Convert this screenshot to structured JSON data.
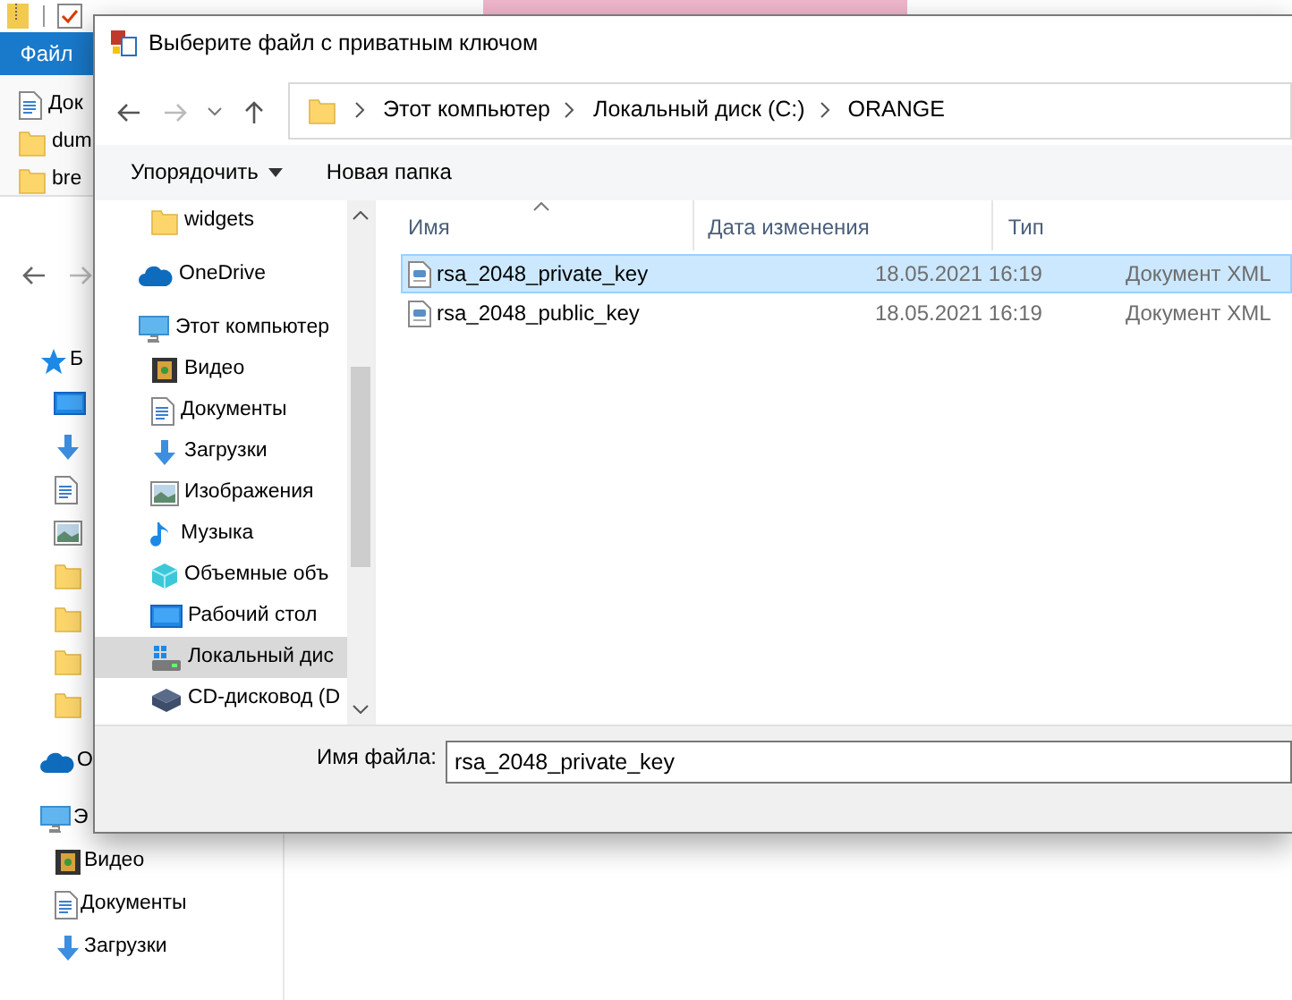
{
  "background_window": {
    "file_tab": "Файл",
    "files": [
      {
        "name": "Док",
        "kind": "document"
      },
      {
        "name": "dum",
        "kind": "folder"
      },
      {
        "name": "bre",
        "kind": "folder"
      }
    ],
    "nav_items": [
      {
        "label": "Б",
        "kind": "star"
      },
      {
        "kind": "desktop"
      },
      {
        "kind": "download"
      },
      {
        "kind": "document"
      },
      {
        "kind": "pictures"
      },
      {
        "kind": "folder"
      },
      {
        "kind": "folder"
      },
      {
        "kind": "folder"
      },
      {
        "kind": "folder"
      },
      {
        "label": "О",
        "kind": "cloud"
      },
      {
        "label": "Э",
        "kind": "computer",
        "children": [
          {
            "label": "Видео",
            "kind": "video"
          },
          {
            "label": "Документы",
            "kind": "document"
          },
          {
            "label": "Загрузки",
            "kind": "download"
          }
        ]
      }
    ]
  },
  "dialog": {
    "title": "Выберите файл с приватным ключом",
    "address": [
      "Этот компьютер",
      "Локальный диск (C:)",
      "ORANGE"
    ],
    "toolbar": {
      "organize": "Упорядочить",
      "new_folder": "Новая папка"
    },
    "nav_pane": [
      {
        "children": [
          {
            "label": "widgets",
            "kind": "folder",
            "selected": false
          }
        ]
      },
      {
        "label": "OneDrive",
        "kind": "cloud",
        "selected": false
      },
      {
        "label": "Этот компьютер",
        "kind": "computer",
        "selected": false,
        "children": [
          {
            "label": "Видео",
            "kind": "video",
            "selected": false
          },
          {
            "label": "Документы",
            "kind": "document",
            "selected": false
          },
          {
            "label": "Загрузки",
            "kind": "download",
            "selected": false
          },
          {
            "label": "Изображения",
            "kind": "pictures",
            "selected": false
          },
          {
            "label": "Музыка",
            "kind": "music",
            "selected": false
          },
          {
            "label": "Объемные объ",
            "kind": "objects3d",
            "selected": false
          },
          {
            "label": "Рабочий стол",
            "kind": "desktop",
            "selected": false
          },
          {
            "label": "Локальный дис",
            "kind": "drive",
            "selected": true
          },
          {
            "label": "CD-дисковод (D",
            "kind": "cd",
            "selected": false
          }
        ]
      }
    ],
    "columns": [
      {
        "label": "Имя",
        "sorted": true
      },
      {
        "label": "Дата изменения",
        "sorted": false
      },
      {
        "label": "Тип",
        "sorted": false
      }
    ],
    "files": [
      {
        "name": "rsa_2048_private_key",
        "date": "18.05.2021 16:19",
        "type": "Документ XML",
        "selected": true
      },
      {
        "name": "rsa_2048_public_key",
        "date": "18.05.2021 16:19",
        "type": "Документ XML",
        "selected": false
      }
    ],
    "file_name": {
      "label": "Имя файла:",
      "value": "rsa_2048_private_key"
    }
  }
}
